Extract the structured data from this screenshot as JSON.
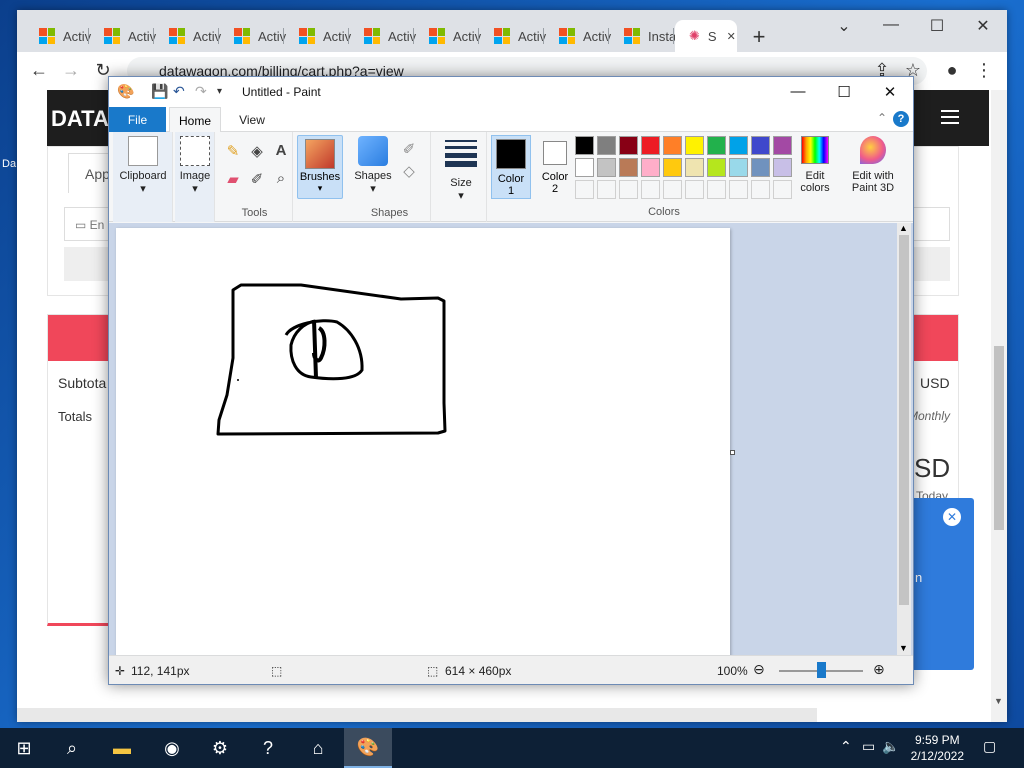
{
  "chrome": {
    "tabs": [
      {
        "label": "Activ"
      },
      {
        "label": "Activ"
      },
      {
        "label": "Activ"
      },
      {
        "label": "Activ"
      },
      {
        "label": "Activ"
      },
      {
        "label": "Activ"
      },
      {
        "label": "Activ"
      },
      {
        "label": "Activ"
      },
      {
        "label": "Activ"
      },
      {
        "label": "Insta"
      },
      {
        "label": "S"
      }
    ],
    "url": "datawagon.com/billing/cart.php?a=view",
    "new_tab": "+",
    "ms_colors": [
      "#f25022",
      "#7fba00",
      "#00a4ef",
      "#ffb900"
    ]
  },
  "page": {
    "site_name": "DATA",
    "left_tab": "App",
    "left_field": "En",
    "subtotal": "Subtota",
    "totals": "Totals",
    "usd": "USD",
    "monthly": "Monthly",
    "sd": "SD",
    "today": "Today",
    "n": "n",
    "side_label": "Da",
    "accent": "#f0475a",
    "panel": "#2f7bdc"
  },
  "paint": {
    "title": "Untitled - Paint",
    "tabs": {
      "file": "File",
      "home": "Home",
      "view": "View"
    },
    "help": "?",
    "groups": {
      "clipboard": "Clipboard",
      "image": "Image",
      "tools": "Tools",
      "brushes": "Brushes",
      "shapes_btn": "Shapes",
      "shapes": "Shapes",
      "size": "Size",
      "color1": "Color\n1",
      "color1a": "Color",
      "color1b": "1",
      "color2a": "Color",
      "color2b": "2",
      "colors": "Colors",
      "edit_colors_a": "Edit",
      "edit_colors_b": "colors",
      "paint3d_a": "Edit with",
      "paint3d_b": "Paint 3D"
    },
    "palette_row1": [
      "#000000",
      "#7f7f7f",
      "#880015",
      "#ed1c24",
      "#ff7f27",
      "#fff200",
      "#22b14c",
      "#00a2e8",
      "#3f48cc",
      "#a349a4"
    ],
    "palette_row2": [
      "#ffffff",
      "#c3c3c3",
      "#b97a57",
      "#ffaec9",
      "#ffc90e",
      "#efe4b0",
      "#b5e61d",
      "#99d9ea",
      "#7092be",
      "#c8bfe7"
    ],
    "status": {
      "cursor": "112, 141px",
      "size": "614 × 460px",
      "zoom": "100%"
    }
  },
  "taskbar": {
    "time": "9:59 PM",
    "date": "2/12/2022"
  }
}
